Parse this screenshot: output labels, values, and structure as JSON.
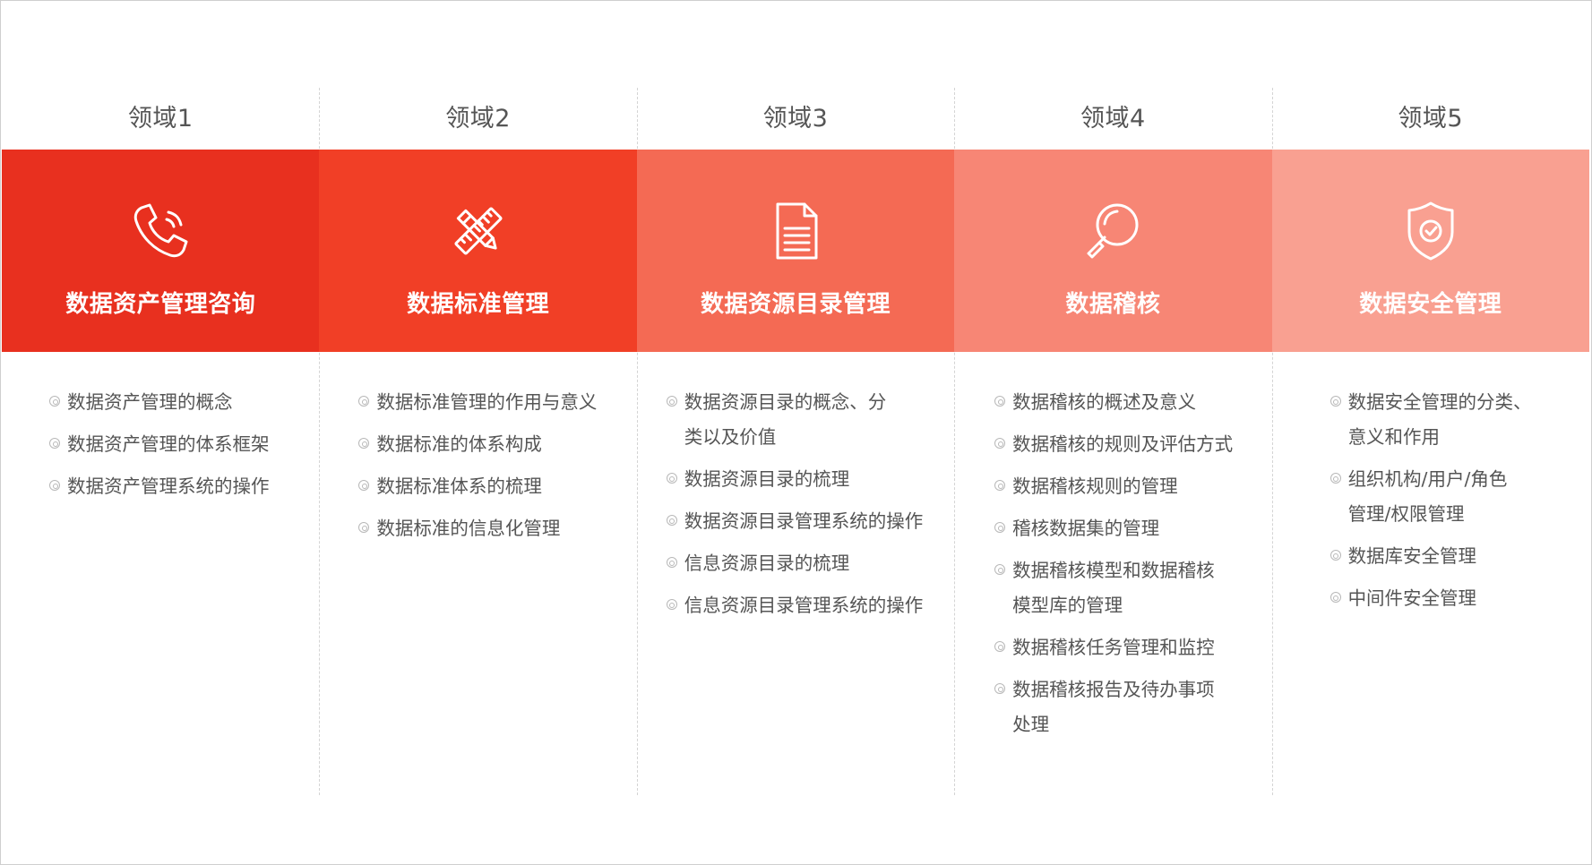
{
  "columns": [
    {
      "label": "领域1",
      "title": "数据资产管理咨询",
      "icon": "phone-icon",
      "color": "#e8301f",
      "items": [
        "数据资产管理的概念",
        "数据资产管理的体系框架",
        "数据资产管理系统的操作"
      ]
    },
    {
      "label": "领域2",
      "title": "数据标准管理",
      "icon": "ruler-pencil-icon",
      "color": "#f13f26",
      "items": [
        "数据标准管理的作用与意义",
        "数据标准的体系构成",
        "数据标准体系的梳理",
        "数据标准的信息化管理"
      ]
    },
    {
      "label": "领域3",
      "title": "数据资源目录管理",
      "icon": "document-icon",
      "color": "#f46a54",
      "items": [
        "数据资源目录的概念、分类以及价值",
        "数据资源目录的梳理",
        "数据资源目录管理系统的操作",
        "信息资源目录的梳理",
        "信息资源目录管理系统的操作"
      ]
    },
    {
      "label": "领域4",
      "title": "数据稽核",
      "icon": "magnifier-icon",
      "color": "#f78675",
      "items": [
        "数据稽核的概述及意义",
        "数据稽核的规则及评估方式",
        "数据稽核规则的管理",
        "稽核数据集的管理",
        "数据稽核模型和数据稽核模型库的管理",
        "数据稽核任务管理和监控",
        "数据稽核报告及待办事项处理"
      ]
    },
    {
      "label": "领域5",
      "title": "数据安全管理",
      "icon": "shield-check-icon",
      "color": "#f9a091",
      "items": [
        "数据安全管理的分类、意义和作用",
        "组织机构/用户/角色管理/权限管理",
        "数据库安全管理",
        "中间件安全管理"
      ]
    }
  ]
}
